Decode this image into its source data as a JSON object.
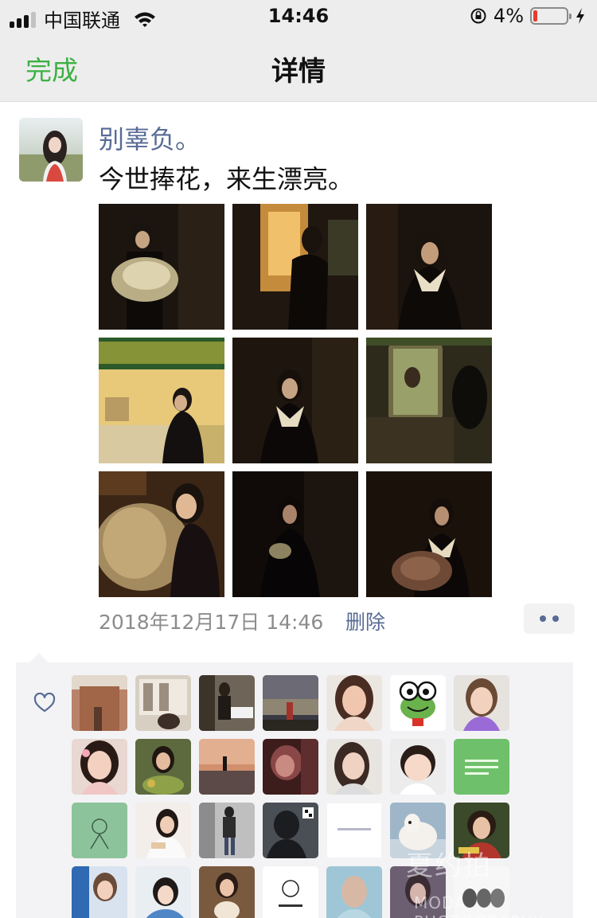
{
  "status_bar": {
    "carrier": "中国联通",
    "time": "14:46",
    "battery_percent": "4%",
    "battery_level": 0.04,
    "icons": [
      "signal-icon",
      "wifi-icon",
      "rotation-lock-icon",
      "battery-icon",
      "charging-bolt-icon"
    ]
  },
  "nav": {
    "done_label": "完成",
    "title": "详情",
    "accent_color": "#3db143"
  },
  "post": {
    "username": "别辜负。",
    "text": "今世捧花，来生漂亮。",
    "timestamp": "2018年12月17日 14:46",
    "delete_label": "删除",
    "link_color": "#576b95",
    "photos": [
      {
        "alt": "photo-1"
      },
      {
        "alt": "photo-2"
      },
      {
        "alt": "photo-3"
      },
      {
        "alt": "photo-4"
      },
      {
        "alt": "photo-5"
      },
      {
        "alt": "photo-6"
      },
      {
        "alt": "photo-7"
      },
      {
        "alt": "photo-8"
      },
      {
        "alt": "photo-9"
      }
    ]
  },
  "likes": {
    "icon": "heart-outline-icon",
    "count_visible": 28
  },
  "watermark": {
    "line1": "夏约拍",
    "line2": "MODA PHOTOGRAPHY"
  }
}
